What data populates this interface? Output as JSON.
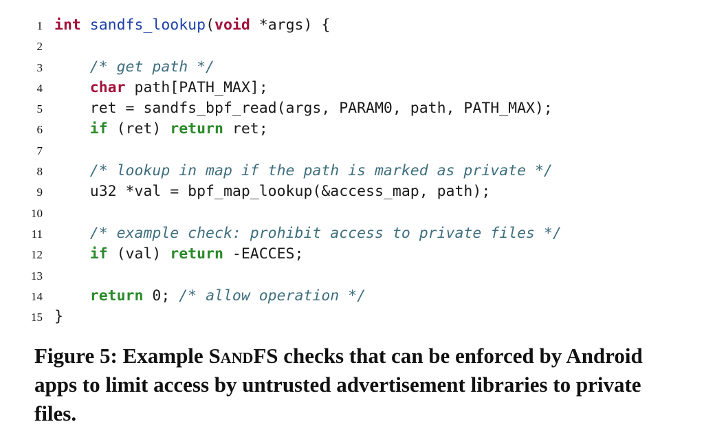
{
  "listing": {
    "line_numbers": [
      "1",
      "2",
      "3",
      "4",
      "5",
      "6",
      "7",
      "8",
      "9",
      "10",
      "11",
      "12",
      "13",
      "14",
      "15"
    ],
    "l1": {
      "kw": "int",
      "fn": "sandfs_lookup",
      "paren": "(",
      "kw2": "void",
      "rest": " *args) {"
    },
    "l3": {
      "indent": "    ",
      "comment": "/* get path */"
    },
    "l4": {
      "indent": "    ",
      "kw": "char",
      "rest": " path[PATH_MAX];"
    },
    "l5": {
      "indent": "    ",
      "text": "ret = sandfs_bpf_read(args, PARAM0, path, PATH_MAX);"
    },
    "l6": {
      "indent": "    ",
      "kw": "if",
      "mid": " (ret) ",
      "kw2": "return",
      "rest": " ret;"
    },
    "l8": {
      "indent": "    ",
      "comment": "/* lookup in map if the path is marked as private */"
    },
    "l9": {
      "indent": "    ",
      "text": "u32 *val = bpf_map_lookup(&access_map, path);"
    },
    "l11": {
      "indent": "    ",
      "comment": "/* example check: prohibit access to private files */"
    },
    "l12": {
      "indent": "    ",
      "kw": "if",
      "mid": " (val) ",
      "kw2": "return",
      "rest": " -EACCES;"
    },
    "l14": {
      "indent": "    ",
      "kw": "return",
      "mid": " 0; ",
      "comment": "/* allow operation */"
    },
    "l15": {
      "text": "}"
    }
  },
  "caption": {
    "prefix": "Figure 5: Example ",
    "name": "SandFS",
    "suffix": " checks that can be enforced by Android apps to limit access by untrusted advertisement libraries to private files."
  }
}
